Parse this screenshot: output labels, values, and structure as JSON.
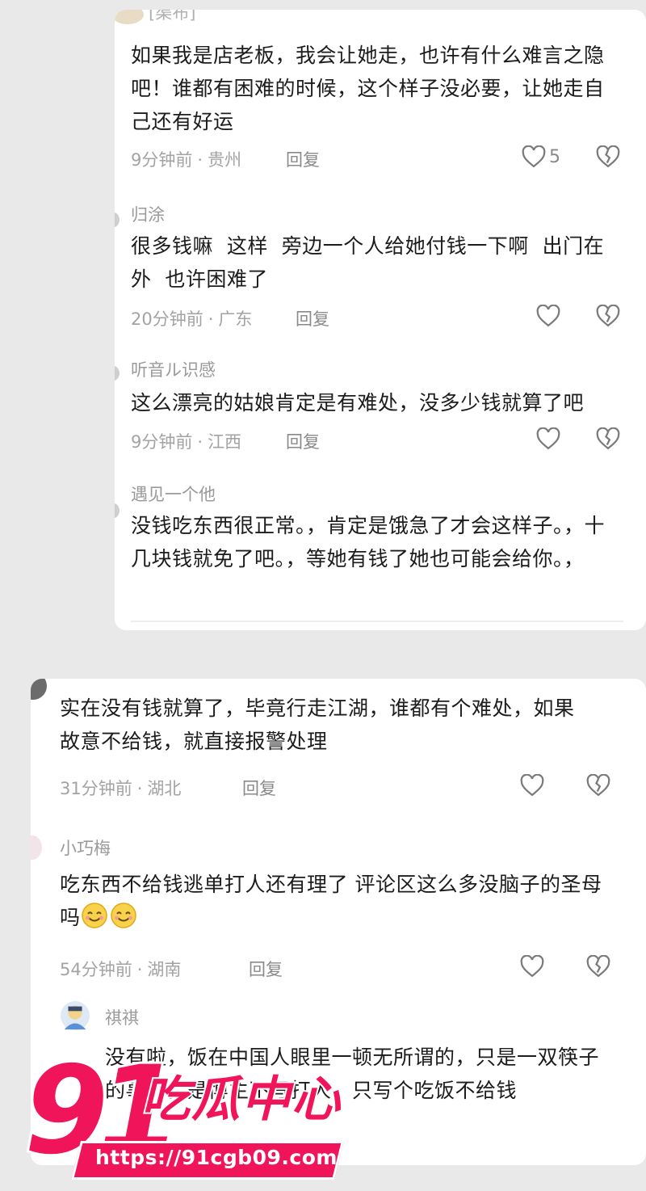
{
  "panel1": {
    "comments": [
      {
        "username": "[渠布]",
        "text": "如果我是店老板，我会让她走，也许有什么难言之隐吧！谁都有困难的时候，这个样子没必要，让她走自己还有好运",
        "time": "9分钟前",
        "location": "贵州",
        "reply": "回复",
        "likes": "5"
      },
      {
        "username": "归涂",
        "text": "很多钱嘛  这样  旁边一个人给她付钱一下啊  出门在外  也许困难了",
        "time": "20分钟前",
        "location": "广东",
        "reply": "回复",
        "likes": ""
      },
      {
        "username": "听音ル识感",
        "text": "这么漂亮的姑娘肯定是有难处，没多少钱就算了吧",
        "time": "9分钟前",
        "location": "江西",
        "reply": "回复",
        "likes": ""
      },
      {
        "username": "遇见一个他",
        "text": "没钱吃东西很正常。，肯定是饿急了才会这样子。，十几块钱就免了吧。，等她有钱了她也可能会给你。，",
        "time": "",
        "location": "",
        "reply": "",
        "likes": ""
      }
    ]
  },
  "panel2": {
    "comments": [
      {
        "username": "",
        "text": "实在没有钱就算了，毕竟行走江湖，谁都有个难处，如果故意不给钱，就直接报警处理",
        "time": "31分钟前",
        "location": "湖北",
        "reply": "回复",
        "likes": ""
      },
      {
        "username": "小巧梅",
        "text": "吃东西不给钱逃单打人还有理了 评论区这么多没脑子的圣母吗",
        "emoji_count": 2,
        "time": "54分钟前",
        "location": "湖南",
        "reply": "回复",
        "likes": ""
      },
      {
        "username": "祺祺",
        "text": "没有啦，饭在中国人眼里一顿无所谓的，只是一双筷子的事情。是博主不写打人，只写个吃饭不给钱",
        "time": "",
        "location": "",
        "reply": "",
        "likes": ""
      }
    ]
  },
  "watermark": {
    "number": "91",
    "brand": "吃瓜中心",
    "url": "https://91cgb09.com"
  },
  "colors": {
    "background": "#e9e9e9",
    "panel": "#ffffff",
    "text": "#1c1c1c",
    "meta": "#a3a3a3",
    "watermark": "#f0145a"
  },
  "icons": [
    "heart-outline-icon",
    "broken-heart-icon",
    "smiley-emoji-icon"
  ]
}
